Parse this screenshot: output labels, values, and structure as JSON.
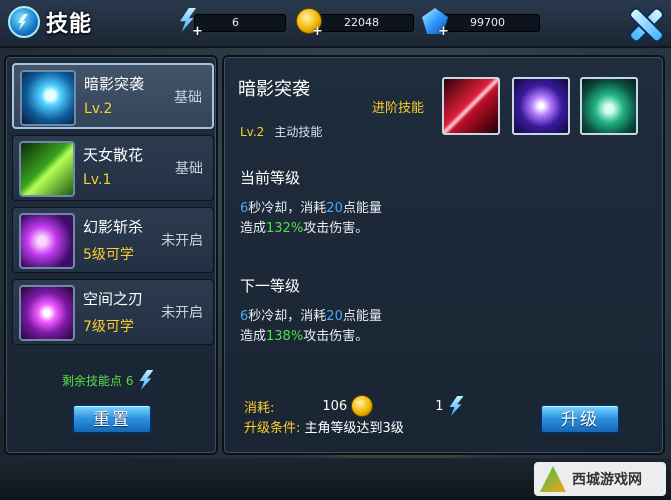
{
  "window": {
    "title": "技能"
  },
  "resources": {
    "energy": "6",
    "gold": "22048",
    "gems": "99700"
  },
  "skills": [
    {
      "name": "暗影突袭",
      "sub": "Lv.2",
      "state": "基础",
      "icon": "shadow-strike-icon"
    },
    {
      "name": "天女散花",
      "sub": "Lv.1",
      "state": "基础",
      "icon": "flower-rain-icon"
    },
    {
      "name": "幻影斩杀",
      "sub": "5级可学",
      "state": "未开启",
      "icon": "phantom-slash-icon"
    },
    {
      "name": "空间之刃",
      "sub": "7级可学",
      "state": "未开启",
      "icon": "space-blade-icon"
    }
  ],
  "points": {
    "label": "剩余技能点 6"
  },
  "buttons": {
    "reset": "重置",
    "upgrade": "升级"
  },
  "detail": {
    "name": "暗影突袭",
    "advanced_label": "进阶技能",
    "level": "Lv.2",
    "type": "主动技能",
    "current_heading": "当前等级",
    "current": {
      "cd": "6",
      "t1": "秒冷却，消耗",
      "energy": "20",
      "t2": "点能量",
      "t3": "造成",
      "pct": "132%",
      "t4": "攻击伤害。"
    },
    "next_heading": "下一等级",
    "next": {
      "cd": "6",
      "t1": "秒冷却，消耗",
      "energy": "20",
      "t2": "点能量",
      "t3": "造成",
      "pct": "138%",
      "t4": "攻击伤害。"
    },
    "cost_label": "消耗:",
    "cost_gold": "106",
    "cost_points": "1",
    "cond_label": "升级条件:",
    "cond_value": "主角等级达到3级"
  },
  "watermark": {
    "text": "西城游戏网"
  },
  "colors": {
    "accent": "#2a8fe0",
    "highlight": "#ffcc2e",
    "green": "#4ee04a",
    "blue": "#44a8ff"
  }
}
